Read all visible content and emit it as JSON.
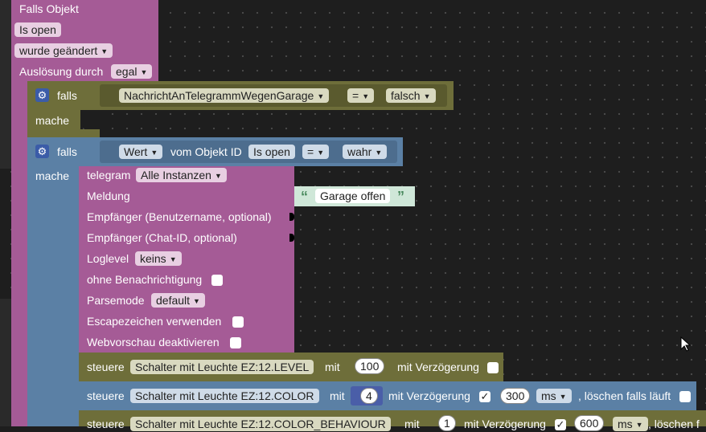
{
  "event_block": {
    "title": "Falls Objekt",
    "state_value": "Is open",
    "trigger": "wurde geändert",
    "trigger_source_label": "Auslösung durch",
    "trigger_source_value": "egal"
  },
  "if_block_1": {
    "if_label": "falls",
    "variable": "NachrichtAnTelegrammWegenGarage",
    "operator": "=",
    "value": "falsch",
    "do_label": "mache"
  },
  "if_block_2": {
    "if_label": "falls",
    "value_label": "Wert",
    "from_object_label": "vom Objekt ID",
    "object_id": "Is open",
    "operator": "=",
    "value": "wahr",
    "do_label": "mache"
  },
  "telegram_block": {
    "title": "telegram",
    "instance": "Alle Instanzen",
    "message_label": "Meldung",
    "message_text": "Garage offen",
    "recipient_user_label": "Empfänger (Benutzername, optional)",
    "recipient_chat_label": "Empfänger (Chat-ID, optional)",
    "loglevel_label": "Loglevel",
    "loglevel_value": "keins",
    "silent_label": "ohne Benachrichtigung",
    "parsemode_label": "Parsemode",
    "parsemode_value": "default",
    "escape_label": "Escapezeichen verwenden",
    "webpreview_label": "Webvorschau deaktivieren"
  },
  "control_1": {
    "label": "steuere",
    "target": "Schalter mit Leuchte EZ:12.LEVEL",
    "with_label": "mit",
    "value": "100",
    "delay_label": "mit Verzögerung"
  },
  "control_2": {
    "label": "steuere",
    "target": "Schalter mit Leuchte EZ:12.COLOR",
    "with_label": "mit",
    "value": "4",
    "delay_label": "mit Verzögerung",
    "delay_checked": "✓",
    "delay_value": "300",
    "unit": "ms",
    "clear_label": ", löschen falls läuft"
  },
  "control_3": {
    "label": "steuere",
    "target": "Schalter mit Leuchte EZ:12.COLOR_BEHAVIOUR",
    "with_label": "mit",
    "value": "1",
    "delay_label": "mit Verzögerung",
    "delay_checked": "✓",
    "delay_value": "600",
    "unit": "ms",
    "clear_label": ", löschen f"
  },
  "icons": {
    "gear": "gear-icon",
    "dropdown": "chevron-down-icon",
    "quote_open": "“",
    "quote_close": "”",
    "cursor": "mouse-cursor-icon"
  },
  "colors": {
    "event": "#a55b96",
    "logic_if": "#6e6e3a",
    "logic_if2": "#5b80a5",
    "telegram": "#a55b96",
    "text": "#cfe7d8",
    "workspace": "#1e1e1e"
  }
}
